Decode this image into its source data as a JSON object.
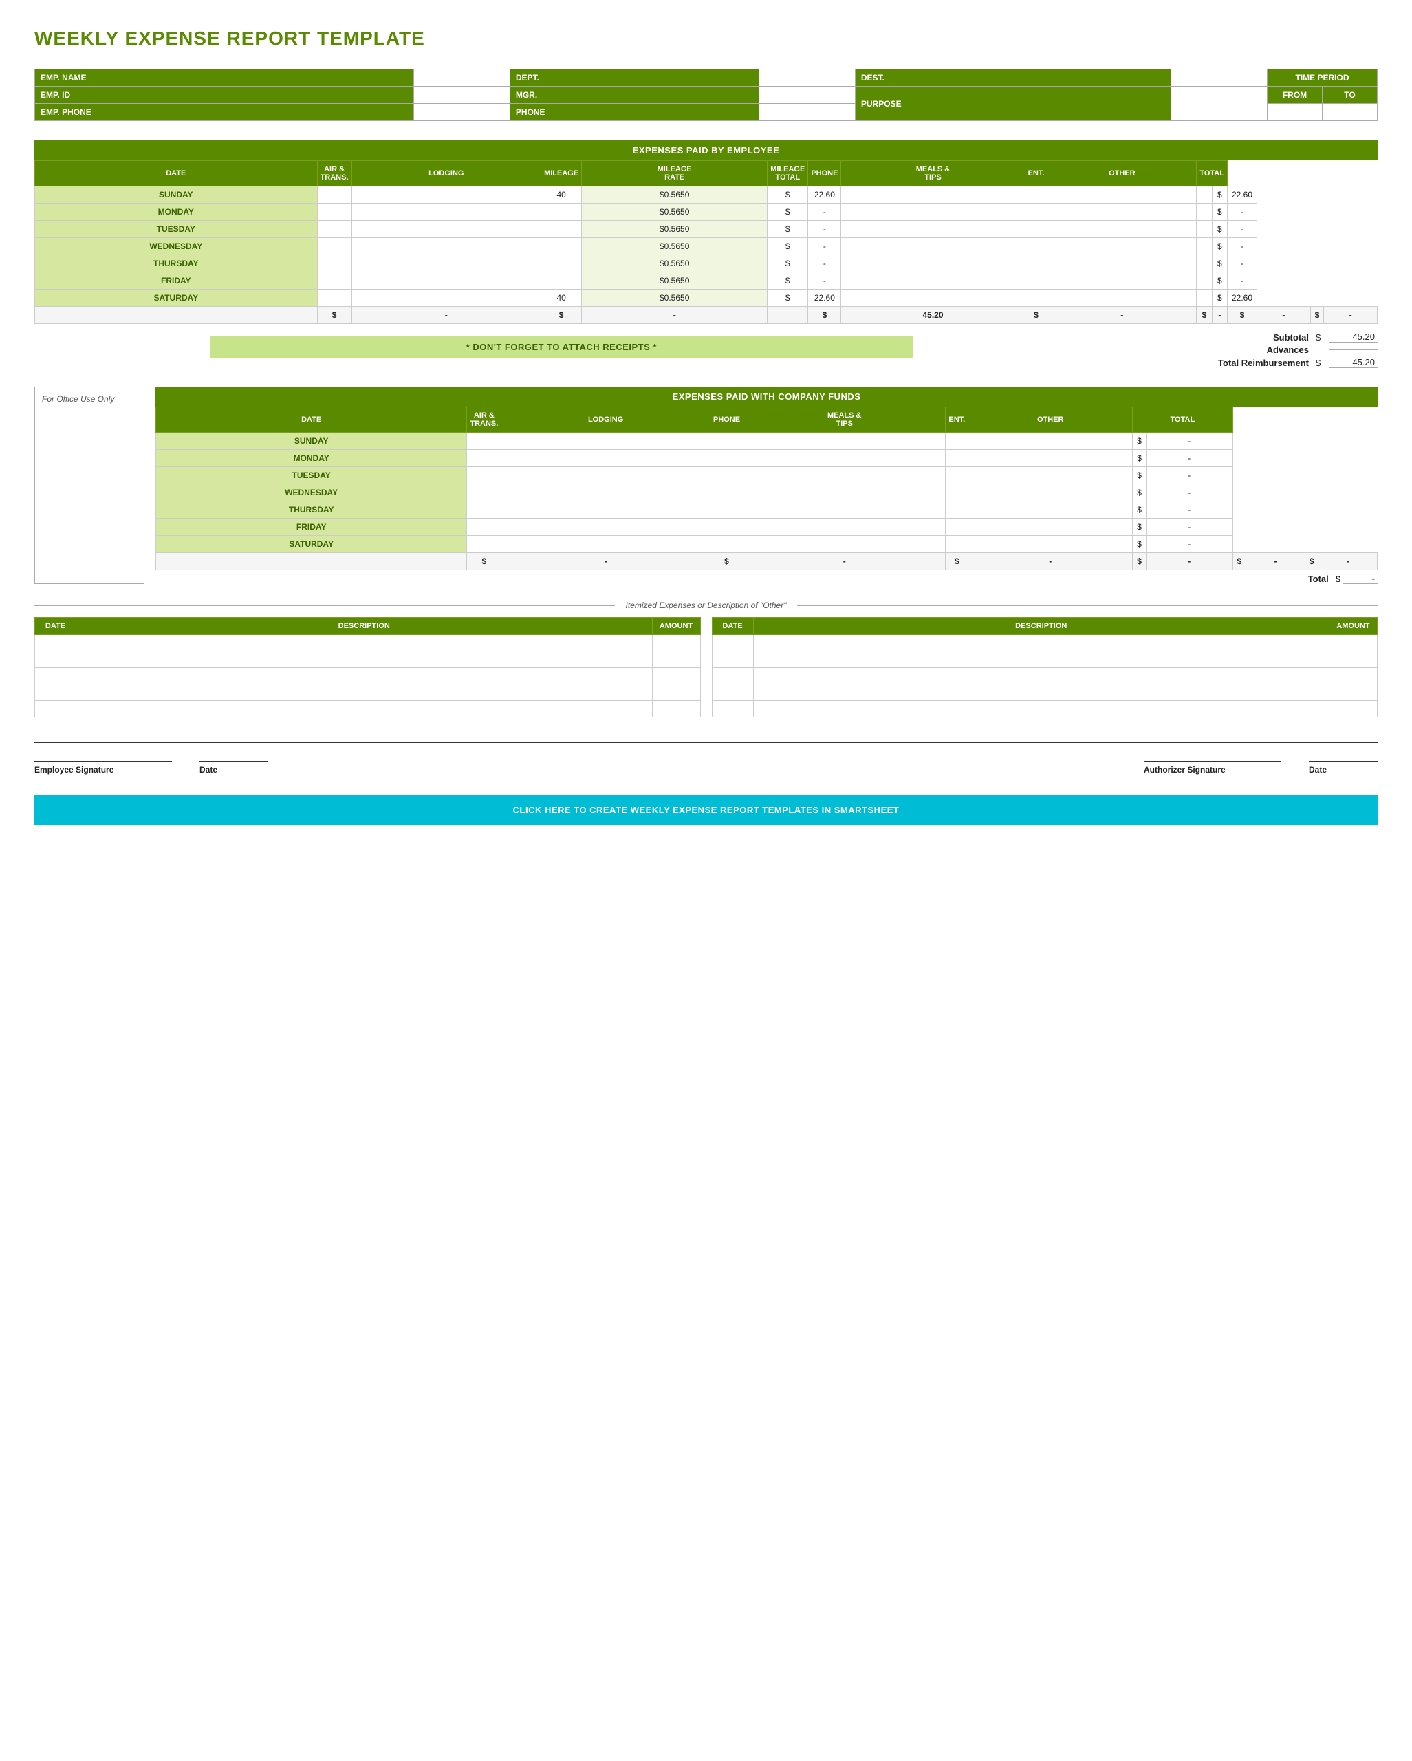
{
  "title": "WEEKLY EXPENSE REPORT TEMPLATE",
  "info": {
    "emp_name_label": "EMP. NAME",
    "dept_label": "DEPT.",
    "dest_label": "DEST.",
    "time_period_label": "TIME PERIOD",
    "emp_id_label": "EMP. ID",
    "mgr_label": "MGR.",
    "purpose_label": "PURPOSE",
    "from_label": "FROM",
    "to_label": "TO",
    "emp_phone_label": "EMP. PHONE",
    "phone_label": "PHONE"
  },
  "employee_section": {
    "header": "EXPENSES PAID BY EMPLOYEE",
    "columns": [
      "DATE",
      "AIR & TRANS.",
      "LODGING",
      "MILEAGE",
      "MILEAGE RATE",
      "MILEAGE TOTAL",
      "PHONE",
      "MEALS & TIPS",
      "ENT.",
      "OTHER",
      "TOTAL"
    ],
    "rows": [
      {
        "day": "SUNDAY",
        "air": "",
        "lodging": "",
        "mileage": "40",
        "rate": "$0.5650",
        "mile_total_dollar": "$",
        "mile_total": "22.60",
        "phone": "",
        "meals": "",
        "ent": "",
        "other": "",
        "total_dollar": "$",
        "total": "22.60"
      },
      {
        "day": "MONDAY",
        "air": "",
        "lodging": "",
        "mileage": "",
        "rate": "$0.5650",
        "mile_total_dollar": "$",
        "mile_total": "-",
        "phone": "",
        "meals": "",
        "ent": "",
        "other": "",
        "total_dollar": "$",
        "total": "-"
      },
      {
        "day": "TUESDAY",
        "air": "",
        "lodging": "",
        "mileage": "",
        "rate": "$0.5650",
        "mile_total_dollar": "$",
        "mile_total": "-",
        "phone": "",
        "meals": "",
        "ent": "",
        "other": "",
        "total_dollar": "$",
        "total": "-"
      },
      {
        "day": "WEDNESDAY",
        "air": "",
        "lodging": "",
        "mileage": "",
        "rate": "$0.5650",
        "mile_total_dollar": "$",
        "mile_total": "-",
        "phone": "",
        "meals": "",
        "ent": "",
        "other": "",
        "total_dollar": "$",
        "total": "-"
      },
      {
        "day": "THURSDAY",
        "air": "",
        "lodging": "",
        "mileage": "",
        "rate": "$0.5650",
        "mile_total_dollar": "$",
        "mile_total": "-",
        "phone": "",
        "meals": "",
        "ent": "",
        "other": "",
        "total_dollar": "$",
        "total": "-"
      },
      {
        "day": "FRIDAY",
        "air": "",
        "lodging": "",
        "mileage": "",
        "rate": "$0.5650",
        "mile_total_dollar": "$",
        "mile_total": "-",
        "phone": "",
        "meals": "",
        "ent": "",
        "other": "",
        "total_dollar": "$",
        "total": "-"
      },
      {
        "day": "SATURDAY",
        "air": "",
        "lodging": "",
        "mileage": "40",
        "rate": "$0.5650",
        "mile_total_dollar": "$",
        "mile_total": "22.60",
        "phone": "",
        "meals": "",
        "ent": "",
        "other": "",
        "total_dollar": "$",
        "total": "22.60"
      }
    ],
    "totals_row": {
      "air_dollar": "$",
      "air": "-",
      "lodging_dollar": "$",
      "lodging": "-",
      "mile_total_dollar": "$",
      "mile_total": "45.20",
      "phone_dollar": "$",
      "phone": "-",
      "meals_dollar": "$",
      "meals": "-",
      "ent_dollar": "$",
      "ent": "-",
      "other_dollar": "$",
      "other": "-"
    },
    "subtotal_label": "Subtotal",
    "subtotal_dollar": "$",
    "subtotal_value": "45.20",
    "advances_label": "Advances",
    "advances_dollar": "",
    "advances_value": "",
    "total_reimb_label": "Total Reimbursement",
    "total_reimb_dollar": "$",
    "total_reimb_value": "45.20",
    "dont_forget": "* DON'T FORGET TO ATTACH RECEIPTS *"
  },
  "office_use": "For Office Use Only",
  "company_section": {
    "header": "EXPENSES PAID WITH COMPANY FUNDS",
    "columns": [
      "DATE",
      "AIR & TRANS.",
      "LODGING",
      "PHONE",
      "MEALS & TIPS",
      "ENT.",
      "OTHER",
      "TOTAL"
    ],
    "rows": [
      {
        "day": "SUNDAY",
        "air": "",
        "lodging": "",
        "phone": "",
        "meals": "",
        "ent": "",
        "other": "",
        "total_dollar": "$",
        "total": "-"
      },
      {
        "day": "MONDAY",
        "air": "",
        "lodging": "",
        "phone": "",
        "meals": "",
        "ent": "",
        "other": "",
        "total_dollar": "$",
        "total": "-"
      },
      {
        "day": "TUESDAY",
        "air": "",
        "lodging": "",
        "phone": "",
        "meals": "",
        "ent": "",
        "other": "",
        "total_dollar": "$",
        "total": "-"
      },
      {
        "day": "WEDNESDAY",
        "air": "",
        "lodging": "",
        "phone": "",
        "meals": "",
        "ent": "",
        "other": "",
        "total_dollar": "$",
        "total": "-"
      },
      {
        "day": "THURSDAY",
        "air": "",
        "lodging": "",
        "phone": "",
        "meals": "",
        "ent": "",
        "other": "",
        "total_dollar": "$",
        "total": "-"
      },
      {
        "day": "FRIDAY",
        "air": "",
        "lodging": "",
        "phone": "",
        "meals": "",
        "ent": "",
        "other": "",
        "total_dollar": "$",
        "total": "-"
      },
      {
        "day": "SATURDAY",
        "air": "",
        "lodging": "",
        "phone": "",
        "meals": "",
        "ent": "",
        "other": "",
        "total_dollar": "$",
        "total": "-"
      }
    ],
    "totals_row": {
      "air_dollar": "$",
      "air": "-",
      "lodging_dollar": "$",
      "lodging": "-",
      "phone_dollar": "$",
      "phone": "-",
      "meals_dollar": "$",
      "meals": "-",
      "ent_dollar": "$",
      "ent": "-",
      "other_dollar": "$",
      "other": "-"
    },
    "total_label": "Total",
    "total_dollar": "$",
    "total_value": "-"
  },
  "itemized": {
    "title": "Itemized Expenses or Description of \"Other\"",
    "left": {
      "columns": [
        "DATE",
        "DESCRIPTION",
        "AMOUNT"
      ],
      "rows": 5
    },
    "right": {
      "columns": [
        "DATE",
        "DESCRIPTION",
        "AMOUNT"
      ],
      "rows": 5
    }
  },
  "signature": {
    "employee_sig_label": "Employee Signature",
    "employee_date_label": "Date",
    "authorizer_sig_label": "Authorizer Signature",
    "authorizer_date_label": "Date"
  },
  "cta": "CLICK HERE TO CREATE WEEKLY EXPENSE REPORT TEMPLATES IN SMARTSHEET",
  "colors": {
    "green_dark": "#4a7c00",
    "green_medium": "#5a8a00",
    "green_light": "#d6e8a0",
    "cyan": "#00bcd4"
  }
}
